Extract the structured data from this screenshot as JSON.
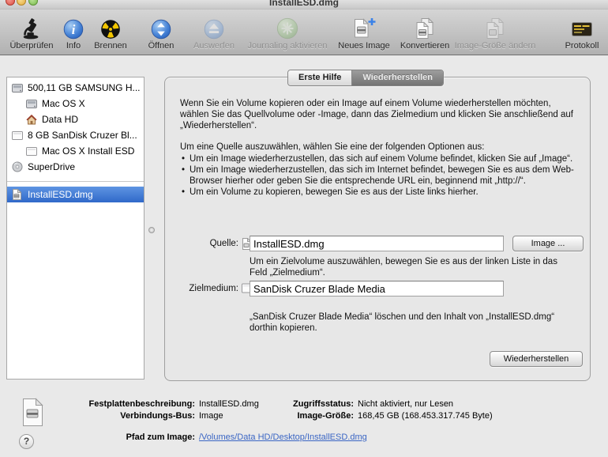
{
  "window": {
    "title": "InstallESD.dmg"
  },
  "toolbar": {
    "items": [
      {
        "label": "Überprüfen",
        "icon": "microscope-icon",
        "enabled": true
      },
      {
        "label": "Info",
        "icon": "info-icon",
        "enabled": true
      },
      {
        "label": "Brennen",
        "icon": "burn-icon",
        "enabled": true
      },
      {
        "label": "Öffnen",
        "icon": "mount-icon",
        "enabled": true
      },
      {
        "label": "Auswerfen",
        "icon": "eject-icon",
        "enabled": false
      },
      {
        "label": "Journaling aktivieren",
        "icon": "journaling-icon",
        "enabled": false
      },
      {
        "label": "Neues Image",
        "icon": "new-image-icon",
        "enabled": true
      },
      {
        "label": "Konvertieren",
        "icon": "convert-icon",
        "enabled": true
      },
      {
        "label": "Image-Größe ändern",
        "icon": "resize-image-icon",
        "enabled": false
      },
      {
        "label": "Protokoll",
        "icon": "log-icon",
        "enabled": true
      }
    ]
  },
  "sidebar": {
    "items": [
      {
        "label": "500,11 GB SAMSUNG H...",
        "icon": "internal-drive",
        "indent": 0,
        "selected": false
      },
      {
        "label": "Mac OS X",
        "icon": "volume",
        "indent": 1,
        "selected": false
      },
      {
        "label": "Data HD",
        "icon": "home-volume",
        "indent": 1,
        "selected": false
      },
      {
        "label": "8 GB SanDisk Cruzer Bl...",
        "icon": "external-drive",
        "indent": 0,
        "selected": false
      },
      {
        "label": "Mac OS X Install ESD",
        "icon": "external-volume",
        "indent": 1,
        "selected": false
      },
      {
        "label": "SuperDrive",
        "icon": "optical-drive",
        "indent": 0,
        "selected": false
      },
      {
        "label": "InstallESD.dmg",
        "icon": "disk-image",
        "indent": 0,
        "selected": true
      }
    ]
  },
  "tabs": {
    "items": [
      {
        "label": "Erste Hilfe",
        "active": false
      },
      {
        "label": "Wiederherstellen",
        "active": true
      }
    ]
  },
  "panel": {
    "intro": "Wenn Sie ein Volume kopieren oder ein Image auf einem Volume wiederherstellen möchten, wählen Sie das Quellvolume oder -Image, dann das Zielmedium und klicken Sie anschließend auf „Wiederherstellen“.",
    "options_heading": "Um eine Quelle auszuwählen, wählen Sie eine der folgenden Optionen aus:",
    "bullets": [
      "Um ein Image wiederherzustellen, das sich auf einem Volume befindet, klicken Sie auf „Image“.",
      "Um ein Image wiederherzustellen, das sich im Internet befindet, bewegen Sie es aus dem Web-Browser hierher oder geben Sie die entsprechende URL ein, beginnend mit „http://“.",
      "Um ein Volume zu kopieren, bewegen Sie es aus der Liste links hierher."
    ],
    "source": {
      "label": "Quelle:",
      "value": "InstallESD.dmg",
      "button": "Image ..."
    },
    "target_help": "Um ein Zielvolume auszuwählen, bewegen Sie es aus der linken Liste in das Feld „Zielmedium“.",
    "target": {
      "label": "Zielmedium:",
      "value": "SanDisk Cruzer Blade Media"
    },
    "confirm_text": "„SanDisk Cruzer Blade Media“ löschen und den Inhalt von „InstallESD.dmg“ dorthin kopieren.",
    "restore_button": "Wiederherstellen"
  },
  "footer": {
    "description": {
      "label": "Festplattenbeschreibung:",
      "value": "InstallESD.dmg"
    },
    "bus": {
      "label": "Verbindungs-Bus:",
      "value": "Image"
    },
    "access": {
      "label": "Zugriffsstatus:",
      "value": "Nicht aktiviert, nur Lesen"
    },
    "size": {
      "label": "Image-Größe:",
      "value": "168,45 GB (168.453.317.745 Byte)"
    },
    "path": {
      "label": "Pfad zum Image:",
      "value": "/Volumes/Data HD/Desktop/InstallESD.dmg"
    },
    "help_label": "?"
  },
  "colors": {
    "selection_blue": "#3069c9",
    "link_blue": "#3b66c4",
    "burn_yellow": "#f2c500",
    "accent_blue_sphere": "#2f6fd0"
  }
}
